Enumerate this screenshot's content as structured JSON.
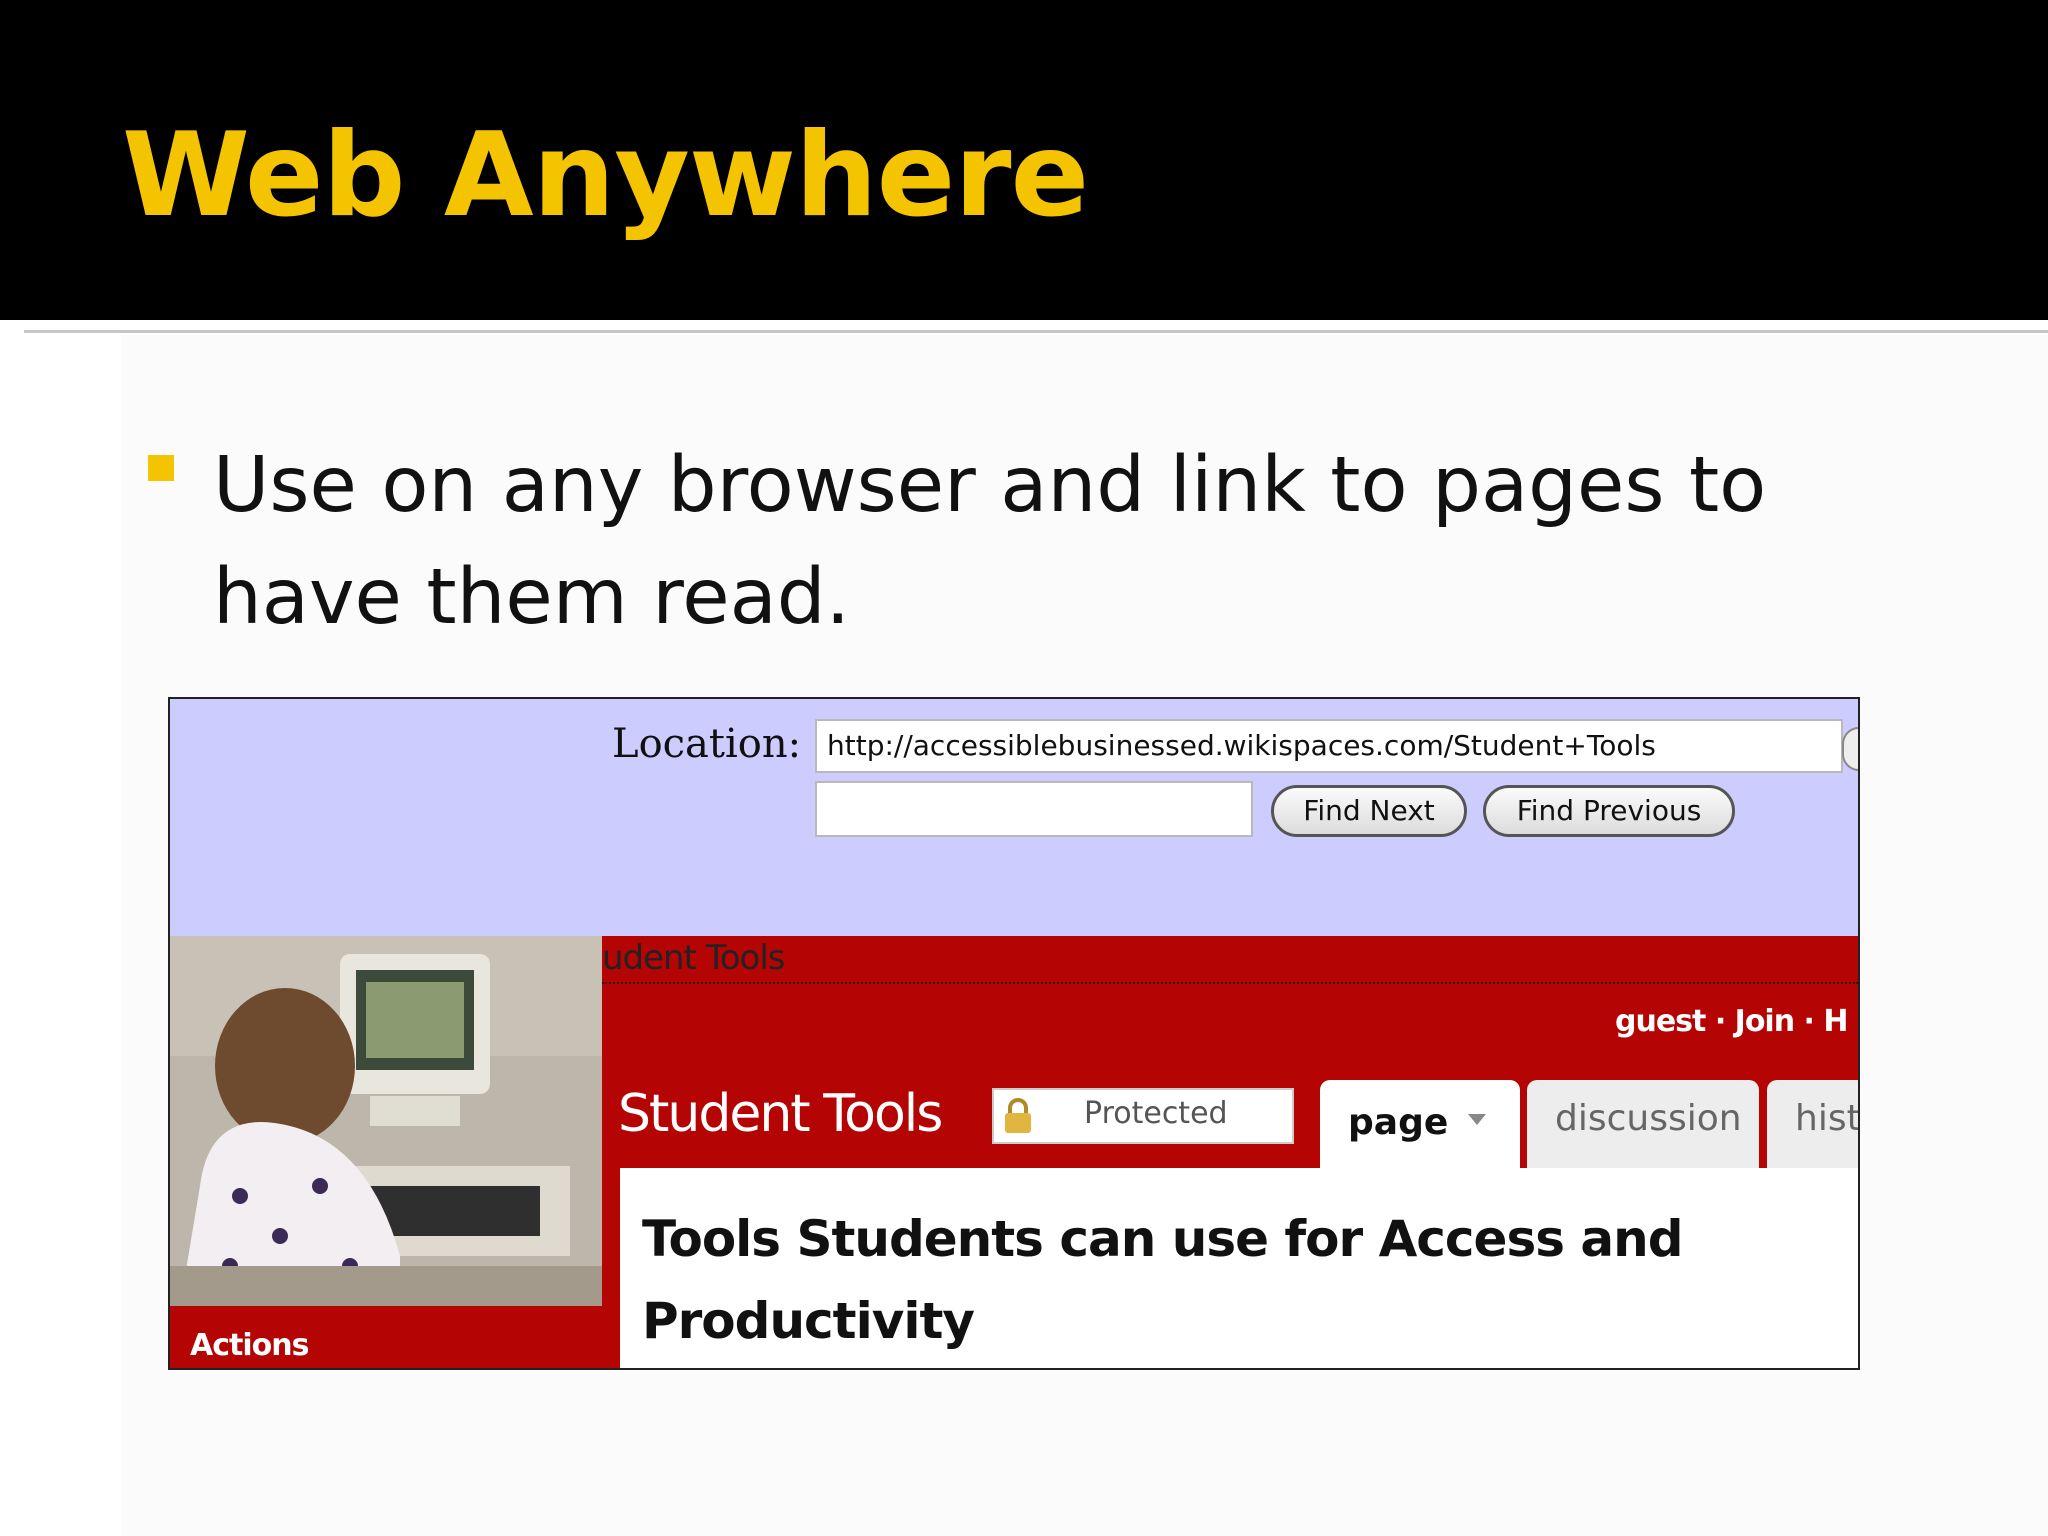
{
  "slide": {
    "title": "Web Anywhere",
    "bullet": "Use on any browser and link to pages to have them read.",
    "accent_color": "#f5c400"
  },
  "screenshot": {
    "location_label": "Location:",
    "location_url": "http://accessiblebusinessed.wikispaces.com/Student+Tools",
    "find_value": "",
    "find_next_label": "Find Next",
    "find_previous_label": "Find Previous",
    "wiki": {
      "breadcrumb": "udent Tools",
      "user_links": "guest · Join · H",
      "page_title": "Student Tools",
      "protected_label": "Protected",
      "tabs": [
        "page",
        "discussion",
        "hist"
      ],
      "heading": "Tools Students can use for Access and Productivity",
      "actions_label": "Actions",
      "brand_color": "#b50404"
    }
  }
}
